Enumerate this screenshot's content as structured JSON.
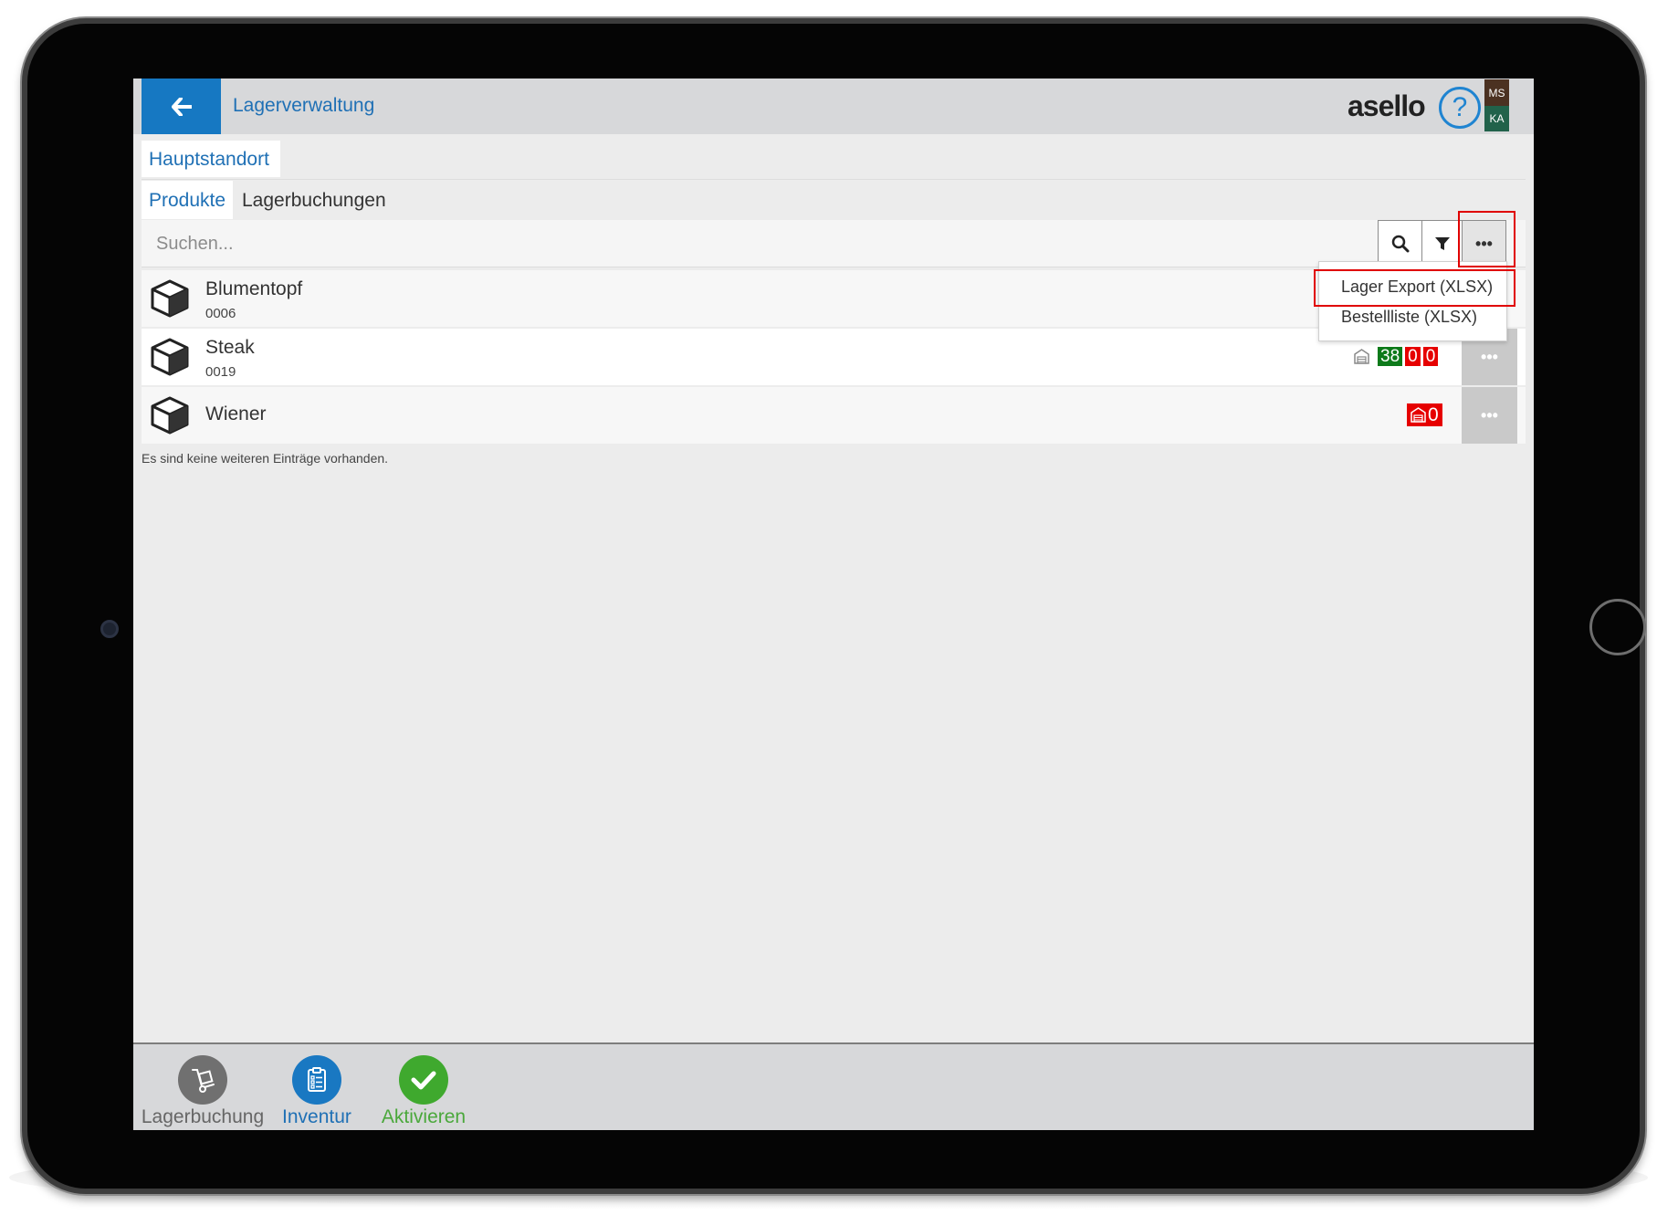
{
  "header": {
    "title": "Lagerverwaltung",
    "logo": "asello",
    "help_symbol": "?",
    "user_top": "MS",
    "user_bottom": "KA",
    "colors": {
      "header_bg": "#d7d8da",
      "back_button": "#1678c2",
      "accent": "#1f70b5"
    }
  },
  "location": {
    "label": "Hauptstandort"
  },
  "tabs": [
    {
      "label": "Produkte",
      "active": true
    },
    {
      "label": "Lagerbuchungen",
      "active": false
    }
  ],
  "search": {
    "placeholder": "Suchen...",
    "value": ""
  },
  "toolbar": {
    "search_icon": "search-icon",
    "filter_icon": "filter-icon",
    "more_label": "•••"
  },
  "dropdown": {
    "items": [
      {
        "label": "Lager Export (XLSX)",
        "highlighted": true
      },
      {
        "label": "Bestellliste (XLSX)",
        "highlighted": false
      }
    ]
  },
  "products": [
    {
      "name": "Blumentopf",
      "number": "0006",
      "icon": "box-icon",
      "stock": []
    },
    {
      "name": "Steak",
      "number": "0019",
      "icon": "box-icon",
      "stock": [
        {
          "value": "38",
          "color": "#0d7a1a"
        },
        {
          "value": "0",
          "color": "#e60000"
        },
        {
          "value": "0",
          "color": "#e60000"
        }
      ],
      "warehouse_icon": "warehouse-icon"
    },
    {
      "name": "Wiener",
      "number": "",
      "icon": "box-icon",
      "stock": [
        {
          "value": "0",
          "color": "#e60000"
        }
      ],
      "warehouse_icon": "warehouse-icon"
    }
  ],
  "row_more_label": "•••",
  "no_more_entries": "Es sind keine weiteren Einträge vorhanden.",
  "footer": {
    "items": [
      {
        "label": "Lagerbuchung",
        "icon": "hand-truck-icon",
        "color": "#707070"
      },
      {
        "label": "Inventur",
        "icon": "clipboard-icon",
        "color": "#1978c2"
      },
      {
        "label": "Aktivieren",
        "icon": "check-icon",
        "color": "#3fa92e"
      }
    ]
  },
  "annotations": {
    "highlight_color": "#e00000"
  }
}
